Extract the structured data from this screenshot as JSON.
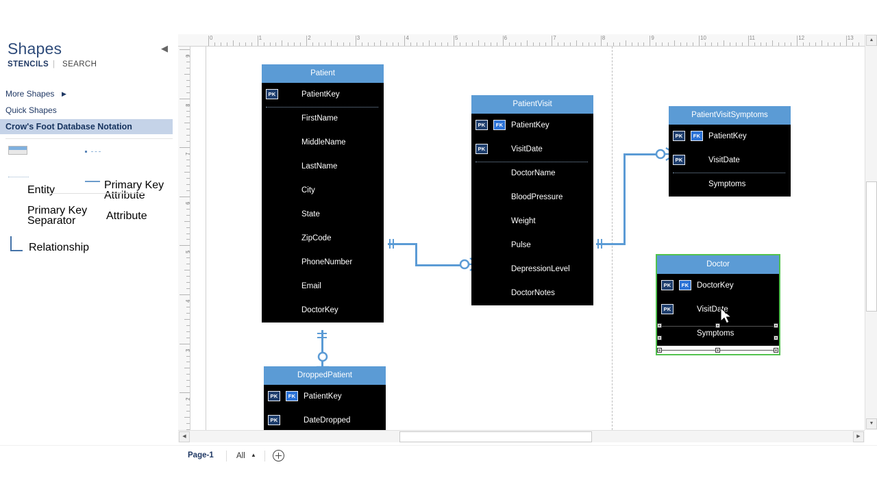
{
  "panel": {
    "title": "Shapes",
    "collapse_icon": "chevron-left-icon",
    "tabs": {
      "stencils": "STENCILS",
      "separator": "|",
      "search": "SEARCH"
    },
    "rows": {
      "more_shapes": "More Shapes",
      "more_shapes_arrow": "▶",
      "quick_shapes": "Quick Shapes",
      "active_stencil": "Crow's Foot Database Notation"
    },
    "stencils": [
      {
        "label": "Entity",
        "icon": "entity-shape-icon"
      },
      {
        "label": "Primary Key\nAttribute",
        "icon": "primary-key-attribute-icon"
      },
      {
        "label": "Primary Key\nSeparator",
        "icon": "primary-key-separator-icon"
      },
      {
        "label": "Attribute",
        "icon": "attribute-icon"
      },
      {
        "label": "Relationship",
        "icon": "relationship-icon"
      }
    ]
  },
  "rulers": {
    "horizontal_labels": [
      "0",
      "1",
      "2",
      "3",
      "4",
      "5",
      "6",
      "7",
      "8",
      "9",
      "10",
      "11",
      "12",
      "13"
    ],
    "vertical_labels": [
      "9",
      "8",
      "7",
      "6",
      "5",
      "4",
      "3",
      "2"
    ],
    "unit": "in"
  },
  "canvas": {
    "entities": [
      {
        "name": "Patient",
        "selected": false,
        "attributes": [
          {
            "pk": true,
            "fk": false,
            "name": "PatientKey"
          },
          {
            "pk": false,
            "fk": false,
            "name": "FirstName"
          },
          {
            "pk": false,
            "fk": false,
            "name": "MiddleName"
          },
          {
            "pk": false,
            "fk": false,
            "name": "LastName"
          },
          {
            "pk": false,
            "fk": false,
            "name": "City"
          },
          {
            "pk": false,
            "fk": false,
            "name": "State"
          },
          {
            "pk": false,
            "fk": false,
            "name": "ZipCode"
          },
          {
            "pk": false,
            "fk": false,
            "name": "PhoneNumber"
          },
          {
            "pk": false,
            "fk": false,
            "name": "Email"
          },
          {
            "pk": false,
            "fk": false,
            "name": "DoctorKey"
          }
        ],
        "separator_after": 1
      },
      {
        "name": "PatientVisit",
        "selected": false,
        "attributes": [
          {
            "pk": true,
            "fk": true,
            "name": "PatientKey"
          },
          {
            "pk": true,
            "fk": false,
            "name": "VisitDate"
          },
          {
            "pk": false,
            "fk": false,
            "name": "DoctorName"
          },
          {
            "pk": false,
            "fk": false,
            "name": "BloodPressure"
          },
          {
            "pk": false,
            "fk": false,
            "name": "Weight"
          },
          {
            "pk": false,
            "fk": false,
            "name": "Pulse"
          },
          {
            "pk": false,
            "fk": false,
            "name": "DepressionLevel"
          },
          {
            "pk": false,
            "fk": false,
            "name": "DoctorNotes"
          }
        ],
        "separator_after": 2
      },
      {
        "name": "PatientVisitSymptoms",
        "selected": false,
        "attributes": [
          {
            "pk": true,
            "fk": true,
            "name": "PatientKey"
          },
          {
            "pk": true,
            "fk": false,
            "name": "VisitDate"
          },
          {
            "pk": false,
            "fk": false,
            "name": "Symptoms"
          }
        ],
        "separator_after": 2
      },
      {
        "name": "Doctor",
        "selected": true,
        "attributes": [
          {
            "pk": true,
            "fk": true,
            "name": "DoctorKey"
          },
          {
            "pk": true,
            "fk": false,
            "name": "VisitDate"
          },
          {
            "pk": false,
            "fk": false,
            "name": "Symptoms"
          }
        ],
        "separator_after": 2
      },
      {
        "name": "DroppedPatient",
        "selected": false,
        "attributes": [
          {
            "pk": true,
            "fk": true,
            "name": "PatientKey"
          },
          {
            "pk": true,
            "fk": false,
            "name": "DateDropped"
          }
        ],
        "separator_after": 2
      }
    ],
    "relationships": [
      {
        "from": "Patient",
        "to": "PatientVisit",
        "from_card": "one-and-only-one",
        "to_card": "zero-or-many"
      },
      {
        "from": "PatientVisit",
        "to": "PatientVisitSymptoms",
        "from_card": "one-and-only-one",
        "to_card": "zero-or-many"
      },
      {
        "from": "Patient",
        "to": "DroppedPatient",
        "from_card": "one-and-only-one",
        "to_card": "zero-or-one"
      }
    ],
    "selection": {
      "target": "Doctor",
      "sub_selected_row": "Symptoms",
      "color": "#52c24e"
    },
    "cursor": "arrow-move-cursor"
  },
  "colors": {
    "entity_header": "#5b9bd5",
    "entity_body": "#000000",
    "pk_badge": "#1f3f6e",
    "fk_badge": "#2b72d6",
    "connector": "#5b9bd5",
    "selection_green": "#52c24e",
    "panel_highlight": "#c5d3e8"
  },
  "statusbar": {
    "page_tab": "Page-1",
    "all_label": "All",
    "all_caret": "▲",
    "add_page_icon": "plus-circle-icon"
  },
  "scrollbars": {
    "vertical": {
      "up_icon": "▲",
      "down_icon": "▼"
    },
    "horizontal": {
      "left_icon": "◀",
      "right_icon": "▶"
    }
  }
}
